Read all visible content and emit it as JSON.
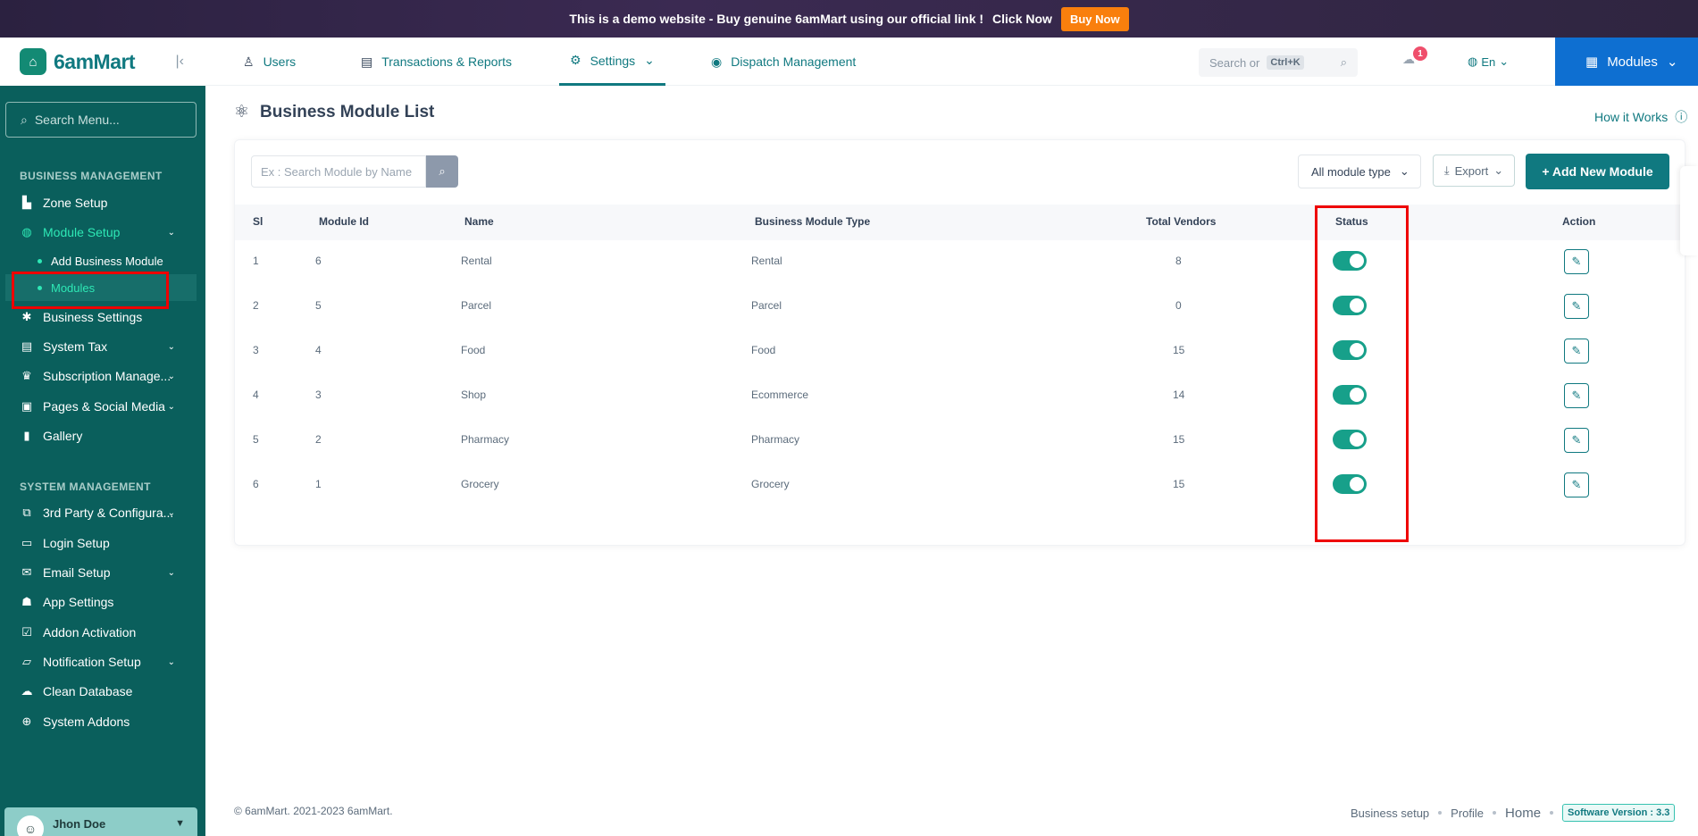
{
  "banner": {
    "text": "This is a demo website - Buy genuine 6amMart using our official link !",
    "click_label": "Click Now",
    "buy_label": "Buy Now"
  },
  "brand": {
    "name": "6amMart"
  },
  "sidebar": {
    "search_placeholder": "Search Menu...",
    "section_business": "BUSINESS MANAGEMENT",
    "section_system": "SYSTEM MANAGEMENT",
    "items": [
      {
        "label": "Zone Setup",
        "icon": "zone-icon"
      },
      {
        "label": "Module Setup",
        "icon": "globe-icon"
      },
      {
        "label": "Business Settings",
        "icon": "gear-icon"
      },
      {
        "label": "System Tax",
        "icon": "tax-icon"
      },
      {
        "label": "Subscription Manage...",
        "icon": "crown-icon"
      },
      {
        "label": "Pages & Social Media",
        "icon": "pages-icon"
      },
      {
        "label": "Gallery",
        "icon": "gallery-icon"
      },
      {
        "label": "3rd Party & Configura...",
        "icon": "plug-icon"
      },
      {
        "label": "Login Setup",
        "icon": "login-icon"
      },
      {
        "label": "Email Setup",
        "icon": "email-icon"
      },
      {
        "label": "App Settings",
        "icon": "android-icon"
      },
      {
        "label": "Addon Activation",
        "icon": "calendar-check-icon"
      },
      {
        "label": "Notification Setup",
        "icon": "notification-icon"
      },
      {
        "label": "Clean Database",
        "icon": "cloud-icon"
      },
      {
        "label": "System Addons",
        "icon": "plus-circle-icon"
      }
    ],
    "sub_items": [
      "Add Business Module",
      "Modules"
    ],
    "user_name": "Jhon Doe"
  },
  "topnav": {
    "tabs": [
      "Users",
      "Transactions & Reports",
      "Settings",
      "Dispatch Management"
    ],
    "search_text": "Search or",
    "shortcut": "Ctrl+K",
    "notification_count": "1",
    "language": "En",
    "modules_label": "Modules"
  },
  "page": {
    "title": "Business Module List",
    "how_it_works": "How it Works",
    "search_placeholder": "Ex : Search Module by Name",
    "module_type_selected": "All module type",
    "export_label": "Export",
    "add_label": "+ Add New Module"
  },
  "table": {
    "headers": [
      "Sl",
      "Module Id",
      "Name",
      "Business Module Type",
      "Total Vendors",
      "Status",
      "Action"
    ],
    "rows": [
      {
        "sl": "1",
        "id": "6",
        "name": "Rental",
        "type": "Rental",
        "vendors": "8",
        "status": true
      },
      {
        "sl": "2",
        "id": "5",
        "name": "Parcel",
        "type": "Parcel",
        "vendors": "0",
        "status": true
      },
      {
        "sl": "3",
        "id": "4",
        "name": "Food",
        "type": "Food",
        "vendors": "15",
        "status": true
      },
      {
        "sl": "4",
        "id": "3",
        "name": "Shop",
        "type": "Ecommerce",
        "vendors": "14",
        "status": true
      },
      {
        "sl": "5",
        "id": "2",
        "name": "Pharmacy",
        "type": "Pharmacy",
        "vendors": "15",
        "status": true
      },
      {
        "sl": "6",
        "id": "1",
        "name": "Grocery",
        "type": "Grocery",
        "vendors": "15",
        "status": true
      }
    ]
  },
  "footer": {
    "copyright": "© 6amMart. 2021-2023 6amMart.",
    "links": [
      "Business setup",
      "Profile",
      "Home"
    ],
    "version": "Software Version : 3.3"
  },
  "colors": {
    "primary": "#107980",
    "sidebar": "#0a5f5c",
    "accent": "#2ee8b5",
    "highlight": "#ee0000"
  }
}
